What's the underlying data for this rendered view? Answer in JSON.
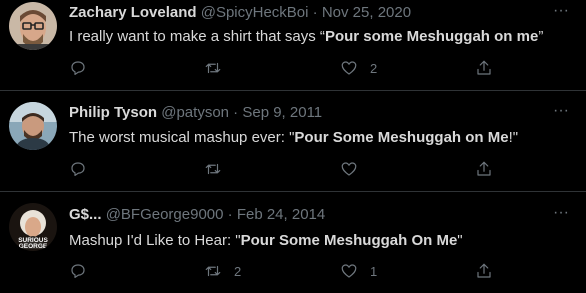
{
  "tweets": [
    {
      "name": "Zachary Loveland",
      "handle": "@SpicyHeckBoi",
      "sep": "·",
      "date": "Nov 25, 2020",
      "text_before": "I really want to make a shirt that says “",
      "text_bold": "Pour some Meshuggah on me",
      "text_after": "”",
      "reply_count": "",
      "retweet_count": "",
      "like_count": "2"
    },
    {
      "name": "Philip Tyson",
      "handle": "@patyson",
      "sep": "·",
      "date": "Sep 9, 2011",
      "text_before": "The worst musical mashup ever: \"",
      "text_bold": "Pour Some Meshuggah on Me",
      "text_after": "!\"",
      "reply_count": "",
      "retweet_count": "",
      "like_count": ""
    },
    {
      "name": "G$...",
      "handle": "@BFGeorge9000",
      "sep": "·",
      "date": "Feb 24, 2014",
      "text_before": "Mashup I'd Like to Hear: \"",
      "text_bold": "Pour Some Meshuggah On Me",
      "text_after": "\"",
      "avatar_text": "SURIOUS GEORGE",
      "reply_count": "",
      "retweet_count": "2",
      "like_count": "1"
    }
  ],
  "icons": {
    "reply": "reply-icon",
    "retweet": "retweet-icon",
    "like": "like-icon",
    "share": "share-icon",
    "more": "more-icon"
  },
  "colors": {
    "background": "#000000",
    "text": "#d9d9d9",
    "muted": "#6e767d",
    "divider": "#2f3336"
  }
}
